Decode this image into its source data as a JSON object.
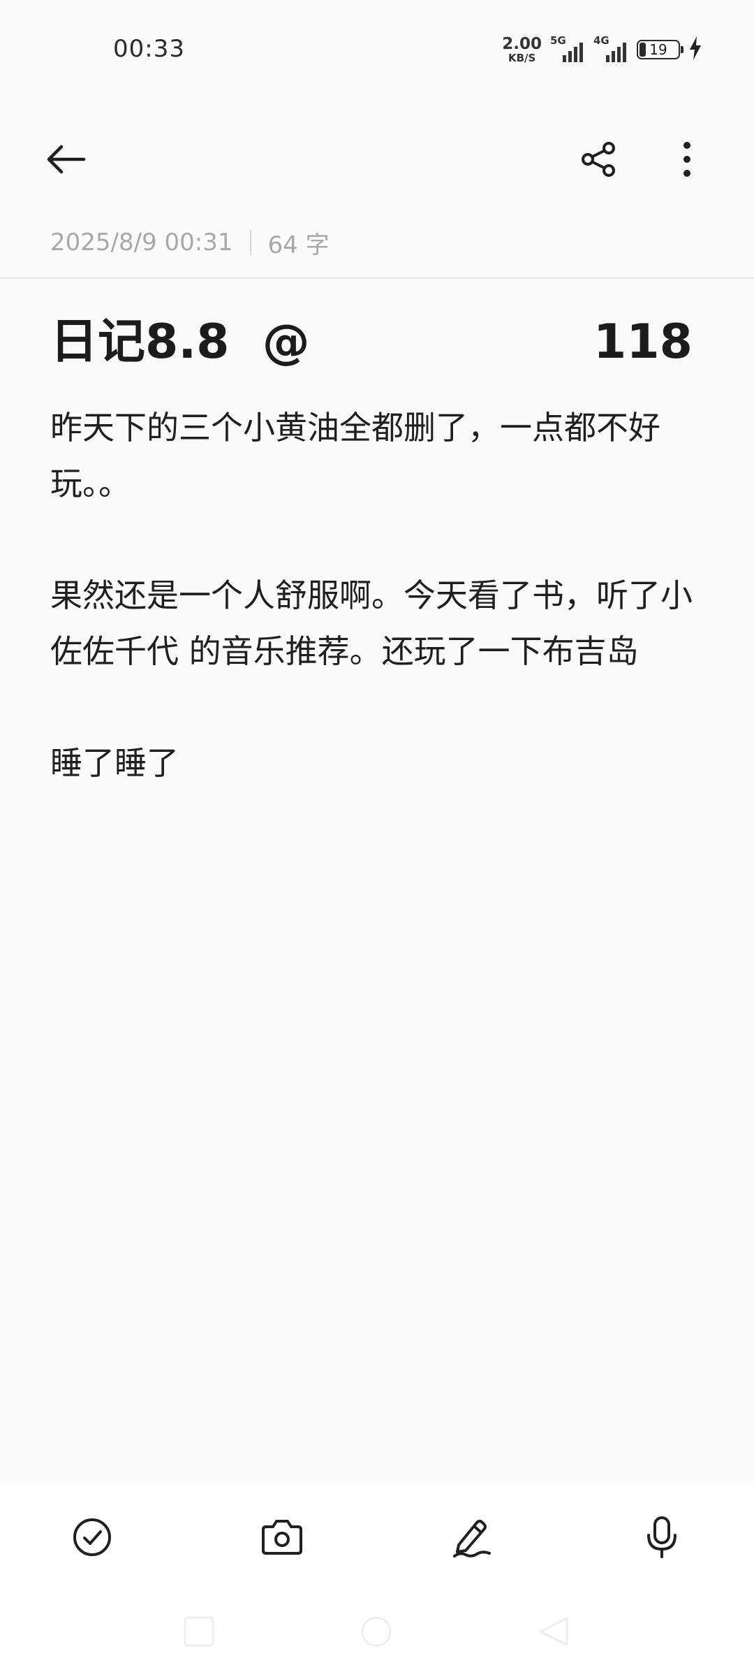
{
  "status_bar": {
    "time": "00:33",
    "net_speed_value": "2.00",
    "net_speed_unit": "KB/S",
    "sim1_label": "5G",
    "sim2_label": "4G",
    "battery_level": "19",
    "icons": {
      "signal_1": "signal-bars-icon",
      "signal_2": "signal-bars-icon",
      "battery": "battery-icon",
      "charging": "charging-bolt-icon"
    }
  },
  "toolbar": {
    "icons": {
      "back": "arrow-left-icon",
      "share": "share-icon",
      "more": "more-vertical-icon"
    }
  },
  "meta": {
    "datetime": "2025/8/9 00:31",
    "word_count": "64 字"
  },
  "note": {
    "title": "日记8.8  @",
    "title_number": "118",
    "paragraphs": [
      "昨天下的三个小黄油全都删了，一点都不好玩。。",
      "果然还是一个人舒服啊。今天看了书，听了小佐佐千代 的音乐推荐。还玩了一下布吉岛",
      "睡了睡了"
    ]
  },
  "bottom_toolbar": {
    "icons": {
      "checklist": "check-circle-icon",
      "camera": "camera-icon",
      "handwriting": "pen-icon",
      "voice": "microphone-icon"
    }
  },
  "colors": {
    "background": "#fafafa",
    "text": "#1f1f1f",
    "meta_text": "#a8a8a8",
    "bottom_bar": "#ffffff"
  }
}
